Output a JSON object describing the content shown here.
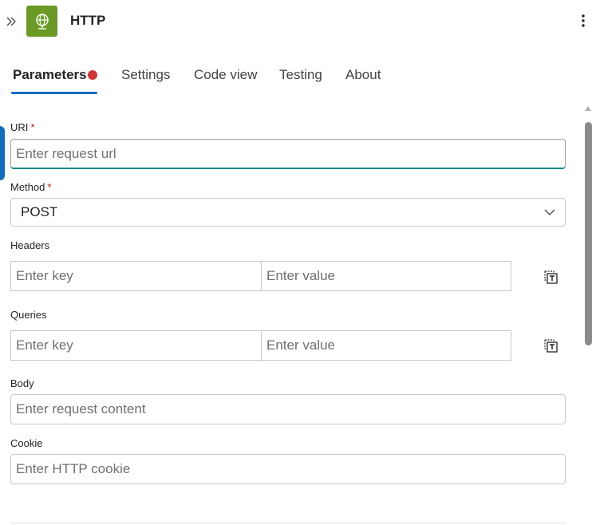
{
  "header": {
    "title": "HTTP",
    "collapse_icon": "double-chevron-right-icon",
    "app_icon": "globe-icon",
    "app_icon_color": "#6a9a24",
    "more_icon": "more-vertical-icon"
  },
  "tabs": [
    {
      "label": "Parameters",
      "active": true,
      "has_error": true
    },
    {
      "label": "Settings"
    },
    {
      "label": "Code view"
    },
    {
      "label": "Testing"
    },
    {
      "label": "About"
    }
  ],
  "form": {
    "uri": {
      "label": "URI",
      "required_mark": "*",
      "placeholder": "Enter request url"
    },
    "method": {
      "label": "Method",
      "required_mark": "*",
      "value": "POST"
    },
    "headers": {
      "label": "Headers",
      "key_placeholder": "Enter key",
      "value_placeholder": "Enter value"
    },
    "queries": {
      "label": "Queries",
      "key_placeholder": "Enter key",
      "value_placeholder": "Enter value"
    },
    "body": {
      "label": "Body",
      "placeholder": "Enter request content"
    },
    "cookie": {
      "label": "Cookie",
      "placeholder": "Enter HTTP cookie"
    }
  },
  "colors": {
    "accent": "#0f6cbd",
    "error": "#d13438",
    "required": "#c50f1f"
  }
}
